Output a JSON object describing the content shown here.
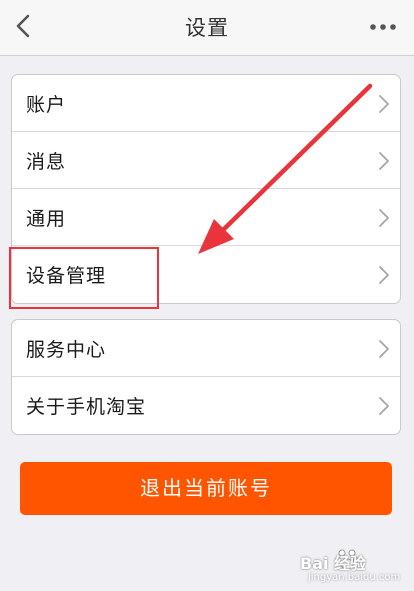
{
  "nav": {
    "title": "设置",
    "back_icon": "chevron-left-icon",
    "more_icon": "more-dots-icon"
  },
  "settings_group_1": {
    "items": [
      {
        "label": "账户"
      },
      {
        "label": "消息"
      },
      {
        "label": "通用"
      },
      {
        "label": "设备管理"
      }
    ]
  },
  "settings_group_2": {
    "items": [
      {
        "label": "服务中心"
      },
      {
        "label": "关于手机淘宝"
      }
    ]
  },
  "logout": {
    "label": "退出当前账号"
  },
  "annotation": {
    "color": "#e8343a"
  },
  "watermark": {
    "text": "Bai 经验",
    "sub": "jingyan.baidu.com"
  },
  "colors": {
    "accent": "#ff5500",
    "background": "#efeff4"
  }
}
